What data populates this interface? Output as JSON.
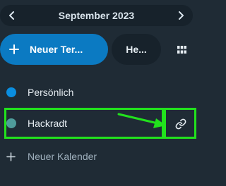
{
  "navigation": {
    "month_label": "September 2023",
    "prev_icon": "chevron-left-icon",
    "next_icon": "chevron-right-icon"
  },
  "actions": {
    "new_event_label": "Neuer Ter...",
    "today_label": "He...",
    "view_icon": "grid-icon"
  },
  "calendars": [
    {
      "name": "Persönlich",
      "color": "#0a8ee0"
    },
    {
      "name": "Hackradt",
      "color": "#4f9c9b",
      "share_icon": "link-icon"
    }
  ],
  "new_calendar": {
    "label": "Neuer Kalender",
    "icon": "plus-icon"
  },
  "colors": {
    "background": "#1f2b35",
    "panel": "#17222b",
    "primary": "#0b7ac2",
    "highlight": "#22e21d"
  }
}
